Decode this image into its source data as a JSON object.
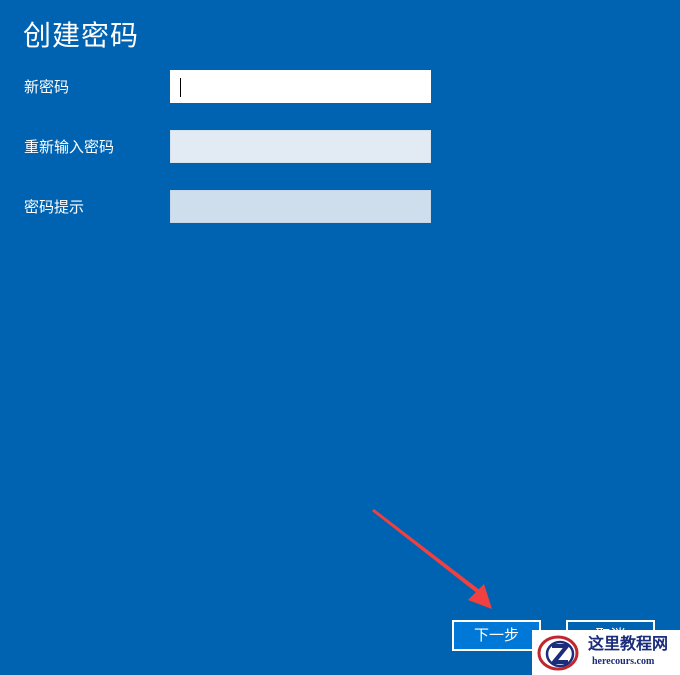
{
  "page": {
    "title": "创建密码"
  },
  "form": {
    "fields": [
      {
        "label": "新密码",
        "value": "",
        "state": "focused"
      },
      {
        "label": "重新输入密码",
        "value": ""
      },
      {
        "label": "密码提示",
        "value": ""
      }
    ]
  },
  "buttons": {
    "next_label": "下一步",
    "cancel_label": "取消"
  },
  "watermark": {
    "title": "这里教程网",
    "url": "herecours.com"
  },
  "colors": {
    "background": "#0063b1",
    "button_accent": "#0078d7",
    "arrow": "#f0403f"
  }
}
